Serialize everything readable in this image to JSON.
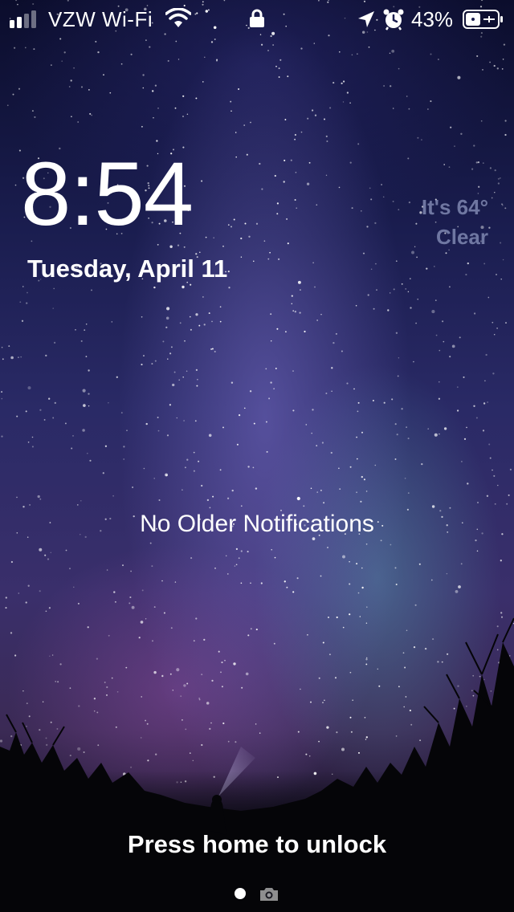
{
  "status_bar": {
    "carrier": "VZW Wi-Fi",
    "battery_percent": "43%",
    "icons": [
      "signal-icon",
      "wifi-icon",
      "lock-icon",
      "location-arrow-icon",
      "alarm-icon",
      "battery-icon"
    ]
  },
  "lock_screen": {
    "time": "8:54",
    "date": "Tuesday, April 11",
    "weather_line1": "It's 64°",
    "weather_line2": "Clear",
    "notifications_text": "No Older Notifications",
    "unlock_hint": "Press home to unlock"
  },
  "page_indicator": {
    "icons": [
      "page-dot-icon",
      "camera-icon"
    ]
  }
}
